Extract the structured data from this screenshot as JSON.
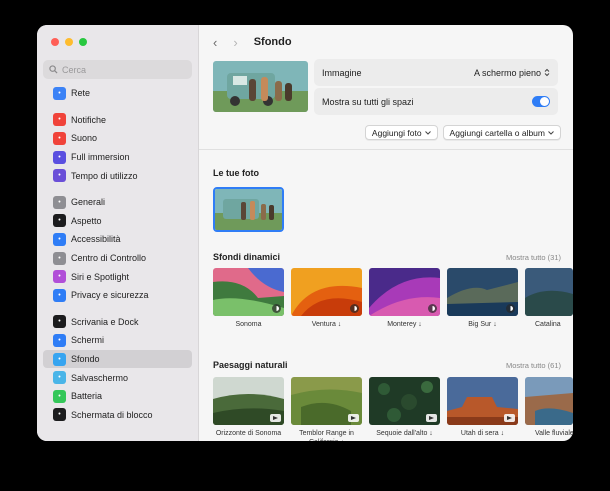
{
  "search": {
    "placeholder": "Cerca"
  },
  "sidebar": {
    "items": [
      {
        "label": "Rete",
        "icon": "globe-icon",
        "color": "#3b82f6"
      },
      {
        "label": "Notifiche",
        "icon": "bell-icon",
        "color": "#f0433a"
      },
      {
        "label": "Suono",
        "icon": "speaker-icon",
        "color": "#f0433a"
      },
      {
        "label": "Full immersion",
        "icon": "moon-icon",
        "color": "#5a4fe0"
      },
      {
        "label": "Tempo di utilizzo",
        "icon": "hourglass-icon",
        "color": "#6a4fd8"
      },
      {
        "label": "Generali",
        "icon": "gear-icon",
        "color": "#8e8e93"
      },
      {
        "label": "Aspetto",
        "icon": "appearance-icon",
        "color": "#1c1c1e"
      },
      {
        "label": "Accessibilità",
        "icon": "accessibility-icon",
        "color": "#2f7df6"
      },
      {
        "label": "Centro di Controllo",
        "icon": "control-center-icon",
        "color": "#8e8e93"
      },
      {
        "label": "Siri e Spotlight",
        "icon": "siri-icon",
        "color": "#b14fd8"
      },
      {
        "label": "Privacy e sicurezza",
        "icon": "hand-icon",
        "color": "#2f7df6"
      },
      {
        "label": "Scrivania e Dock",
        "icon": "dock-icon",
        "color": "#1c1c1e"
      },
      {
        "label": "Schermi",
        "icon": "display-icon",
        "color": "#2f7df6"
      },
      {
        "label": "Sfondo",
        "icon": "wallpaper-icon",
        "color": "#36a4f0",
        "selected": true
      },
      {
        "label": "Salvaschermo",
        "icon": "screensaver-icon",
        "color": "#4ab5e8"
      },
      {
        "label": "Batteria",
        "icon": "battery-icon",
        "color": "#34c759"
      },
      {
        "label": "Schermata di blocco",
        "icon": "lock-icon",
        "color": "#1c1c1e"
      }
    ]
  },
  "header": {
    "title": "Sfondo"
  },
  "settings": {
    "image_label": "Immagine",
    "image_value": "A schermo pieno",
    "all_spaces_label": "Mostra su tutti gli spazi",
    "all_spaces_on": true
  },
  "buttons": {
    "add_photo": "Aggiungi foto",
    "add_folder": "Aggiungi cartella o album"
  },
  "sections": {
    "your_photos": {
      "title": "Le tue foto"
    },
    "dynamic": {
      "title": "Sfondi dinamici",
      "show_all": "Mostra tutto (31)",
      "items": [
        "Sonoma",
        "Ventura ↓",
        "Monterey ↓",
        "Big Sur ↓",
        "Catalina"
      ]
    },
    "landscapes": {
      "title": "Paesaggi naturali",
      "show_all": "Mostra tutto (61)",
      "items": [
        "Orizzonte di Sonoma",
        "Temblor Range in California ↓",
        "Sequoie dall'alto ↓",
        "Utah di sera ↓",
        "Valle fluviale Grand Canyon"
      ]
    }
  },
  "colors": {
    "accent": "#2f7df6",
    "selected_bg": "#d2d0d3"
  }
}
